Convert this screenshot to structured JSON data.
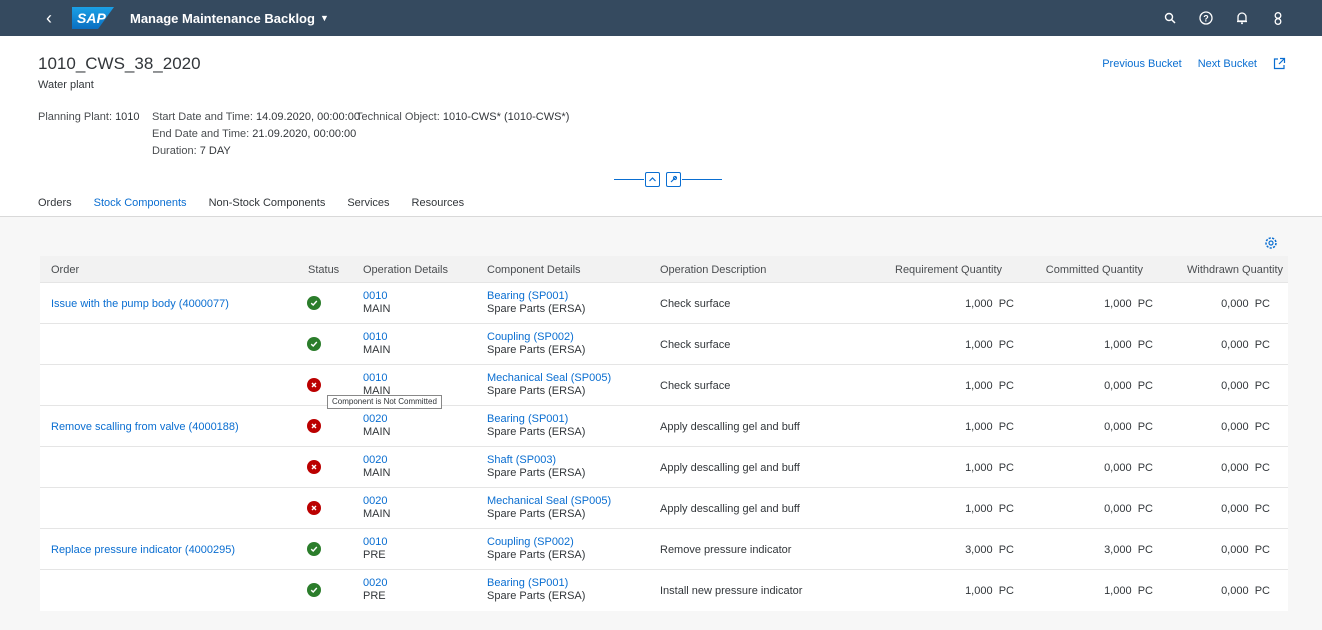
{
  "shell": {
    "logo_text": "SAP",
    "app_title": "Manage Maintenance Backlog",
    "icons": [
      "back-icon",
      "search-icon",
      "help-icon",
      "notifications-icon",
      "user-icon"
    ]
  },
  "header": {
    "title": "1010_CWS_38_2020",
    "subtitle": "Water plant",
    "previous_bucket": "Previous Bucket",
    "next_bucket": "Next Bucket",
    "planning_plant_label": "Planning Plant:",
    "planning_plant_value": "1010",
    "start_label": "Start Date and Time:",
    "start_value": "14.09.2020, 00:00:00",
    "end_label": "End Date and Time:",
    "end_value": "21.09.2020, 00:00:00",
    "duration_label": "Duration:",
    "duration_value": "7 DAY",
    "tech_object_label": "Technical Object:",
    "tech_object_value": "1010-CWS* (1010-CWS*)"
  },
  "tabs": [
    {
      "label": "Orders",
      "active": false
    },
    {
      "label": "Stock Components",
      "active": true
    },
    {
      "label": "Non-Stock Components",
      "active": false
    },
    {
      "label": "Services",
      "active": false
    },
    {
      "label": "Resources",
      "active": false
    }
  ],
  "table": {
    "columns": [
      "Order",
      "Status",
      "Operation Details",
      "Component Details",
      "Operation Description",
      "Requirement Quantity",
      "Committed Quantity",
      "Withdrawn Quantity"
    ],
    "rows": [
      {
        "order": "Issue with the pump body (4000077)",
        "status": "ok",
        "op": "0010",
        "op_sub": "MAIN",
        "comp": "Bearing (SP001)",
        "comp_sub": "Spare Parts (ERSA)",
        "desc": "Check surface",
        "req": "1,000",
        "req_unit": "PC",
        "com": "1,000",
        "com_unit": "PC",
        "wd": "0,000",
        "wd_unit": "PC"
      },
      {
        "order": "",
        "status": "ok",
        "op": "0010",
        "op_sub": "MAIN",
        "comp": "Coupling (SP002)",
        "comp_sub": "Spare Parts (ERSA)",
        "desc": "Check surface",
        "req": "1,000",
        "req_unit": "PC",
        "com": "1,000",
        "com_unit": "PC",
        "wd": "0,000",
        "wd_unit": "PC"
      },
      {
        "order": "",
        "status": "err",
        "op": "0010",
        "op_sub": "MAIN",
        "comp": "Mechanical Seal (SP005)",
        "comp_sub": "Spare Parts (ERSA)",
        "desc": "Check surface",
        "req": "1,000",
        "req_unit": "PC",
        "com": "0,000",
        "com_unit": "PC",
        "wd": "0,000",
        "wd_unit": "PC"
      },
      {
        "order": "Remove scalling from valve (4000188)",
        "status": "err",
        "op": "0020",
        "op_sub": "MAIN",
        "comp": "Bearing (SP001)",
        "comp_sub": "Spare Parts (ERSA)",
        "desc": "Apply descalling gel and buff",
        "req": "1,000",
        "req_unit": "PC",
        "com": "0,000",
        "com_unit": "PC",
        "wd": "0,000",
        "wd_unit": "PC"
      },
      {
        "order": "",
        "status": "err",
        "op": "0020",
        "op_sub": "MAIN",
        "comp": "Shaft (SP003)",
        "comp_sub": "Spare Parts (ERSA)",
        "desc": "Apply descalling gel and buff",
        "req": "1,000",
        "req_unit": "PC",
        "com": "0,000",
        "com_unit": "PC",
        "wd": "0,000",
        "wd_unit": "PC"
      },
      {
        "order": "",
        "status": "err",
        "op": "0020",
        "op_sub": "MAIN",
        "comp": "Mechanical Seal (SP005)",
        "comp_sub": "Spare Parts (ERSA)",
        "desc": "Apply descalling gel and buff",
        "req": "1,000",
        "req_unit": "PC",
        "com": "0,000",
        "com_unit": "PC",
        "wd": "0,000",
        "wd_unit": "PC"
      },
      {
        "order": "Replace pressure indicator (4000295)",
        "status": "ok",
        "op": "0010",
        "op_sub": "PRE",
        "comp": "Coupling (SP002)",
        "comp_sub": "Spare Parts (ERSA)",
        "desc": "Remove pressure indicator",
        "req": "3,000",
        "req_unit": "PC",
        "com": "3,000",
        "com_unit": "PC",
        "wd": "0,000",
        "wd_unit": "PC"
      },
      {
        "order": "",
        "status": "ok",
        "op": "0020",
        "op_sub": "PRE",
        "comp": "Bearing (SP001)",
        "comp_sub": "Spare Parts (ERSA)",
        "desc": "Install new pressure indicator",
        "req": "1,000",
        "req_unit": "PC",
        "com": "1,000",
        "com_unit": "PC",
        "wd": "0,000",
        "wd_unit": "PC"
      }
    ]
  },
  "tooltip": "Component is Not Committed",
  "colors": {
    "shell": "#354a5f",
    "link": "#0a6ed1",
    "success": "#2b7d2b",
    "error": "#bb0000"
  }
}
